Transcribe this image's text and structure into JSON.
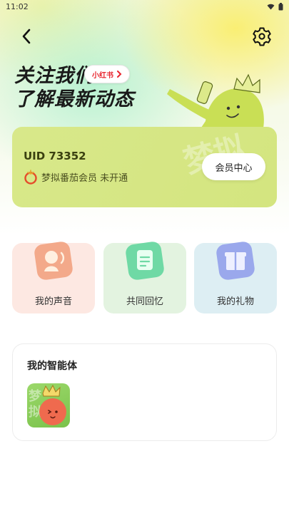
{
  "status_bar": {
    "time": "11:02"
  },
  "header": {
    "back_icon": "chevron-left-icon",
    "settings_icon": "gear-icon"
  },
  "promo": {
    "line1": "关注我们",
    "line2": "了解最新动态",
    "platform_label": "小红书",
    "platform_color": "#e8262f"
  },
  "member": {
    "uid_label": "UID 73352",
    "status_text": "梦拟番茄会员 未开通",
    "center_button": "会员中心",
    "watermark": "梦拟",
    "card_color": "#d6e784"
  },
  "features": [
    {
      "label": "我的声音",
      "icon": "voice-profile-icon",
      "bg": "#fde8e2"
    },
    {
      "label": "共同回忆",
      "icon": "memory-document-icon",
      "bg": "#e3f3e0"
    },
    {
      "label": "我的礼物",
      "icon": "gift-icon",
      "bg": "#ddeef3"
    }
  ],
  "agents": {
    "title": "我的智能体",
    "items": [
      {
        "avatar": "tomato-king-avatar",
        "watermark": "梦拟"
      }
    ]
  }
}
